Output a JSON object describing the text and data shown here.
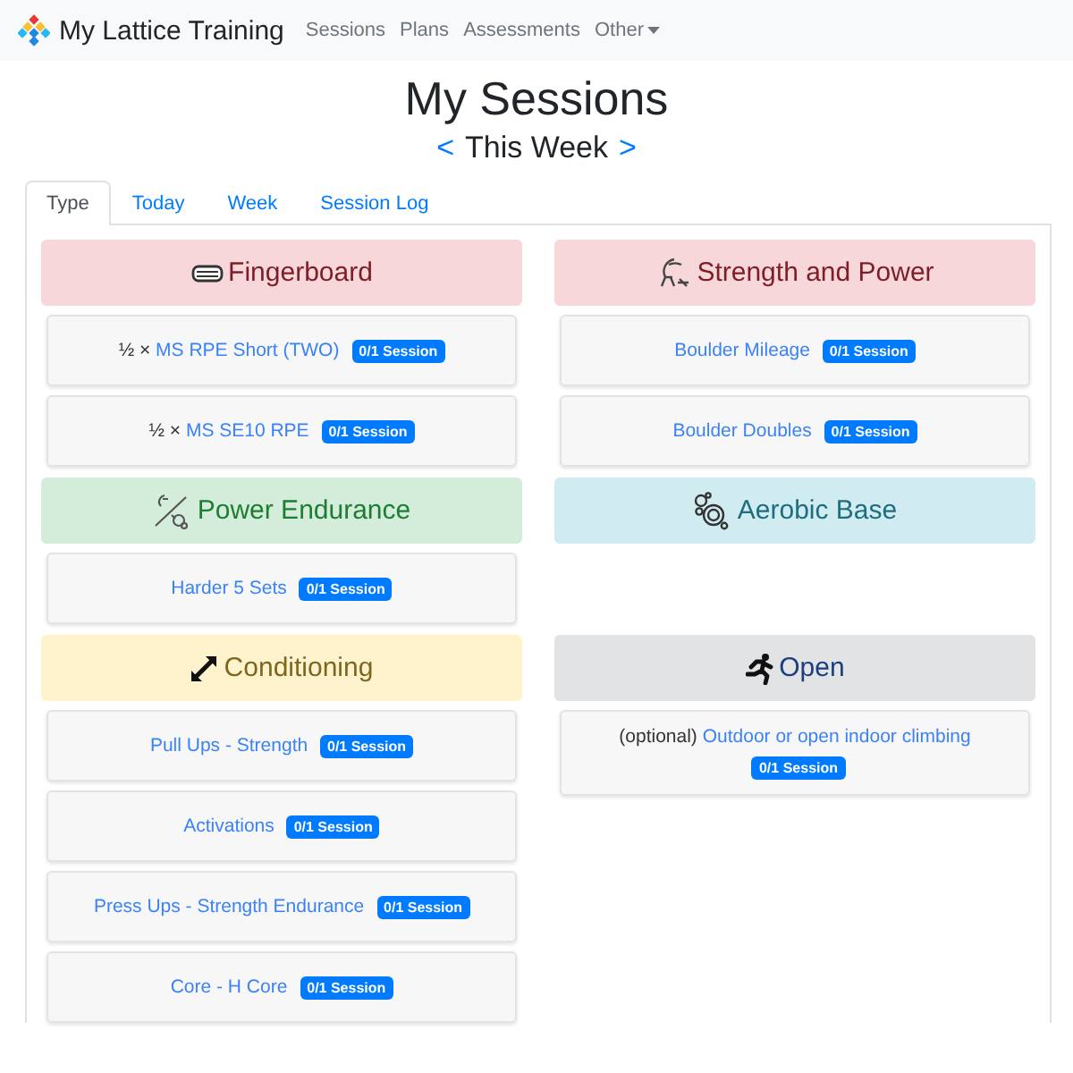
{
  "navbar": {
    "brand": "My Lattice Training",
    "links": [
      {
        "label": "Sessions",
        "dropdown": false
      },
      {
        "label": "Plans",
        "dropdown": false
      },
      {
        "label": "Assessments",
        "dropdown": false
      },
      {
        "label": "Other",
        "dropdown": true
      }
    ]
  },
  "title": "My Sessions",
  "week_nav": {
    "prev": "<",
    "label": "This Week",
    "next": ">"
  },
  "tabs": [
    {
      "label": "Type",
      "selected": true
    },
    {
      "label": "Today",
      "selected": false
    },
    {
      "label": "Week",
      "selected": false
    },
    {
      "label": "Session Log",
      "selected": false
    }
  ],
  "categories": [
    {
      "name": "Fingerboard",
      "kind": "fingerboard",
      "color": "#f8d7da",
      "sessions": [
        {
          "prefix": "½ ×",
          "name": "MS RPE Short (TWO)",
          "badge": "0/1 Session"
        },
        {
          "prefix": "½ ×",
          "name": "MS SE10 RPE",
          "badge": "0/1 Session"
        }
      ]
    },
    {
      "name": "Strength and Power",
      "kind": "strength",
      "color": "#f8d7da",
      "sessions": [
        {
          "name": "Boulder Mileage",
          "badge": "0/1 Session"
        },
        {
          "name": "Boulder Doubles",
          "badge": "0/1 Session"
        }
      ]
    },
    {
      "name": "Power Endurance",
      "kind": "power",
      "color": "#d4edda",
      "sessions": [
        {
          "name": "Harder 5 Sets",
          "badge": "0/1 Session"
        }
      ]
    },
    {
      "name": "Aerobic Base",
      "kind": "aerobic",
      "color": "#d1ecf1"
    },
    {
      "name": "Conditioning",
      "kind": "conditioning",
      "color": "#fff3cd",
      "sessions": [
        {
          "name": "Pull Ups - Strength",
          "badge": "0/1 Session"
        },
        {
          "name": "Activations",
          "badge": "0/1 Session"
        },
        {
          "name": "Press Ups - Strength Endurance",
          "badge": "0/1 Session"
        },
        {
          "name": "Core - H Core",
          "badge": "0/1 Session"
        }
      ]
    },
    {
      "name": "Open",
      "kind": "open",
      "color": "#e2e3e5",
      "sessions": [
        {
          "prefix": "(optional)",
          "name": "Outdoor or open indoor climbing",
          "badge": "0/1 Session"
        }
      ]
    }
  ]
}
